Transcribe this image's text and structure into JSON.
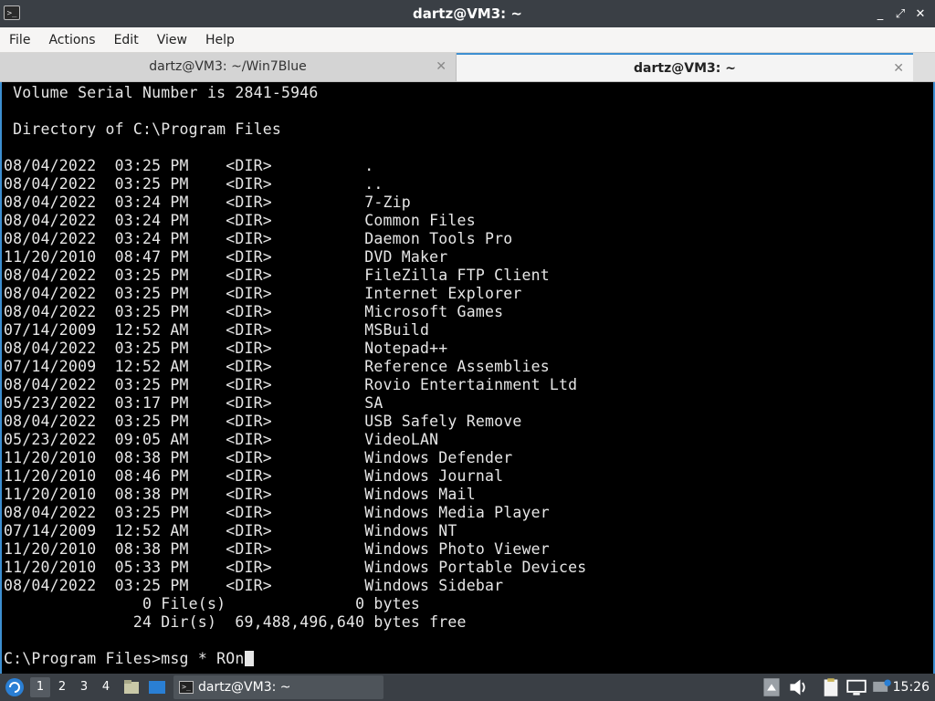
{
  "window": {
    "title": "dartz@VM3: ~",
    "controls": [
      "_",
      "⤢",
      "✕"
    ]
  },
  "menu": [
    "File",
    "Actions",
    "Edit",
    "View",
    "Help"
  ],
  "tabs": [
    {
      "label": "dartz@VM3: ~/Win7Blue",
      "active": false
    },
    {
      "label": "dartz@VM3: ~",
      "active": true
    }
  ],
  "terminal": {
    "lines": [
      " Volume Serial Number is 2841-5946",
      "",
      " Directory of C:\\Program Files",
      "",
      "08/04/2022  03:25 PM    <DIR>          .",
      "08/04/2022  03:25 PM    <DIR>          ..",
      "08/04/2022  03:24 PM    <DIR>          7-Zip",
      "08/04/2022  03:24 PM    <DIR>          Common Files",
      "08/04/2022  03:24 PM    <DIR>          Daemon Tools Pro",
      "11/20/2010  08:47 PM    <DIR>          DVD Maker",
      "08/04/2022  03:25 PM    <DIR>          FileZilla FTP Client",
      "08/04/2022  03:25 PM    <DIR>          Internet Explorer",
      "08/04/2022  03:25 PM    <DIR>          Microsoft Games",
      "07/14/2009  12:52 AM    <DIR>          MSBuild",
      "08/04/2022  03:25 PM    <DIR>          Notepad++",
      "07/14/2009  12:52 AM    <DIR>          Reference Assemblies",
      "08/04/2022  03:25 PM    <DIR>          Rovio Entertainment Ltd",
      "05/23/2022  03:17 PM    <DIR>          SA",
      "08/04/2022  03:25 PM    <DIR>          USB Safely Remove",
      "05/23/2022  09:05 AM    <DIR>          VideoLAN",
      "11/20/2010  08:38 PM    <DIR>          Windows Defender",
      "11/20/2010  08:46 PM    <DIR>          Windows Journal",
      "11/20/2010  08:38 PM    <DIR>          Windows Mail",
      "08/04/2022  03:25 PM    <DIR>          Windows Media Player",
      "07/14/2009  12:52 AM    <DIR>          Windows NT",
      "11/20/2010  08:38 PM    <DIR>          Windows Photo Viewer",
      "11/20/2010  05:33 PM    <DIR>          Windows Portable Devices",
      "08/04/2022  03:25 PM    <DIR>          Windows Sidebar",
      "               0 File(s)              0 bytes",
      "              24 Dir(s)  69,488,496,640 bytes free",
      ""
    ],
    "prompt": "C:\\Program Files>",
    "input": "msg * ROn"
  },
  "taskbar": {
    "workspaces": [
      "1",
      "2",
      "3",
      "4"
    ],
    "active_workspace": "1",
    "task_label": "dartz@VM3: ~",
    "clock": "15:26",
    "tray_icons": [
      "storage-icon",
      "volume-icon",
      "clipboard-icon",
      "display-icon",
      "network-icon"
    ]
  }
}
